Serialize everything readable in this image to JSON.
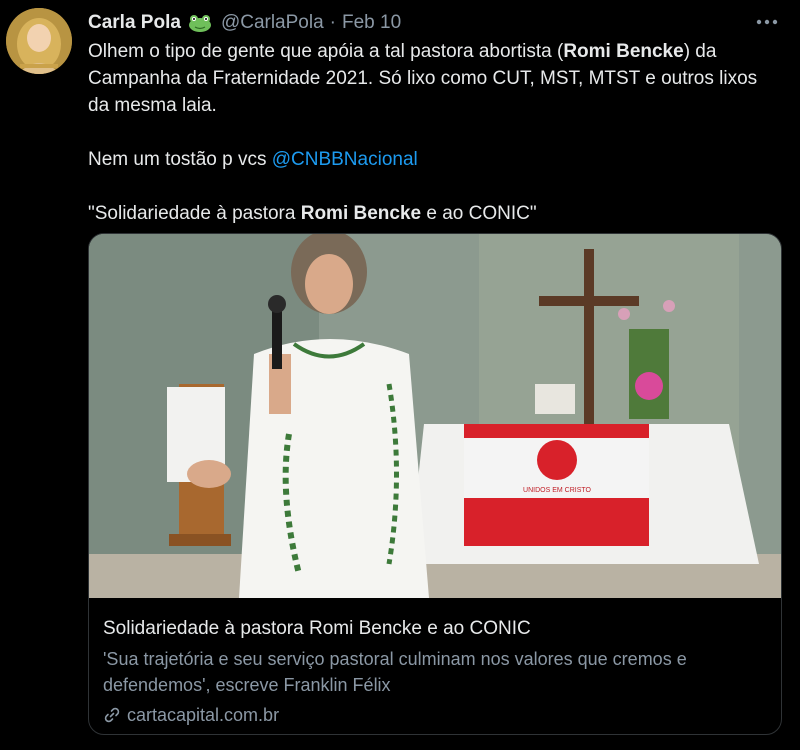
{
  "tweet": {
    "author_name": "Carla Pola",
    "badge_icon": "frog-emoji",
    "handle": "@CarlaPola",
    "separator": "·",
    "date": "Feb 10",
    "more_icon": "more-dots-icon",
    "text": {
      "line1_pre": "Olhem o tipo de gente que apóia a tal pastora abortista (",
      "line1_bold": "Romi Bencke",
      "line1_post": ") da Campanha da Fraternidade 2021. Só lixo como CUT, MST, MTST e outros lixos da mesma laia.",
      "line2_pre": "Nem um tostão p vcs ",
      "line2_mention": "@CNBBNacional",
      "line3_pre": "\"Solidariedade à pastora ",
      "line3_bold": "Romi Bencke",
      "line3_post": " e ao CONIC\""
    },
    "card": {
      "title": "Solidariedade à pastora Romi Bencke e ao CONIC",
      "description": "'Sua trajetória e seu serviço pastoral culminam nos valores que cremos e defendemos', escreve Franklin Félix",
      "domain": "cartacapital.com.br",
      "banner_text": "UNIDOS EM CRISTO"
    }
  },
  "colors": {
    "background": "#000000",
    "text": "#e7e9ea",
    "muted": "#8b98a5",
    "link": "#1d9bf0",
    "card_border": "#2f3336"
  }
}
